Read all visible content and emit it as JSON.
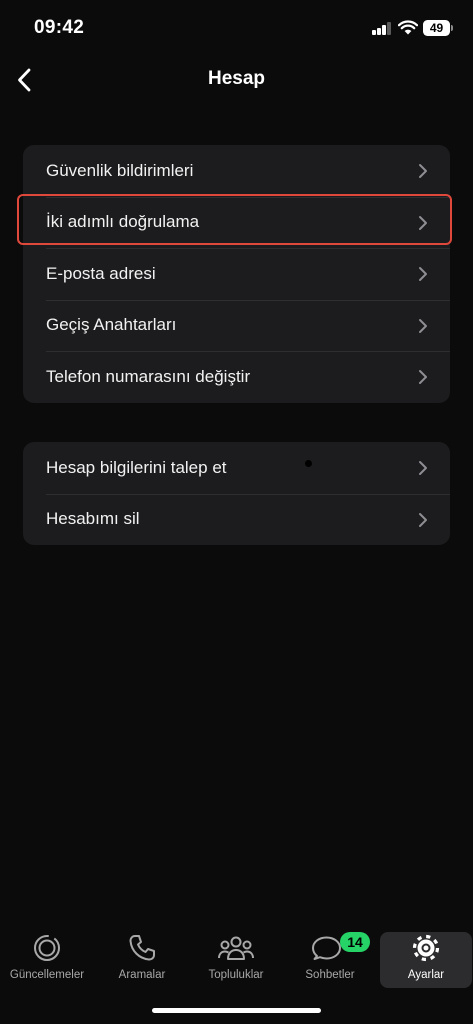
{
  "status_bar": {
    "time": "09:42",
    "battery": "49"
  },
  "nav": {
    "title": "Hesap"
  },
  "groups": [
    {
      "items": [
        {
          "label": "Güvenlik bildirimleri"
        },
        {
          "label": "İki adımlı doğrulama"
        },
        {
          "label": "E-posta adresi"
        },
        {
          "label": "Geçiş Anahtarları"
        },
        {
          "label": "Telefon numarasını değiştir"
        }
      ]
    },
    {
      "items": [
        {
          "label": "Hesap bilgilerini talep et"
        },
        {
          "label": "Hesabımı sil"
        }
      ]
    }
  ],
  "tabs": [
    {
      "label": "Güncellemeler",
      "icon": "updates-icon"
    },
    {
      "label": "Aramalar",
      "icon": "phone-icon"
    },
    {
      "label": "Topluluklar",
      "icon": "communities-icon"
    },
    {
      "label": "Sohbetler",
      "icon": "chats-icon",
      "badge": "14"
    },
    {
      "label": "Ayarlar",
      "icon": "settings-icon",
      "active": true
    }
  ],
  "colors": {
    "highlight": "#e0483c",
    "badge": "#25d366",
    "background": "#0b0b0b",
    "card": "#1c1c1e"
  }
}
